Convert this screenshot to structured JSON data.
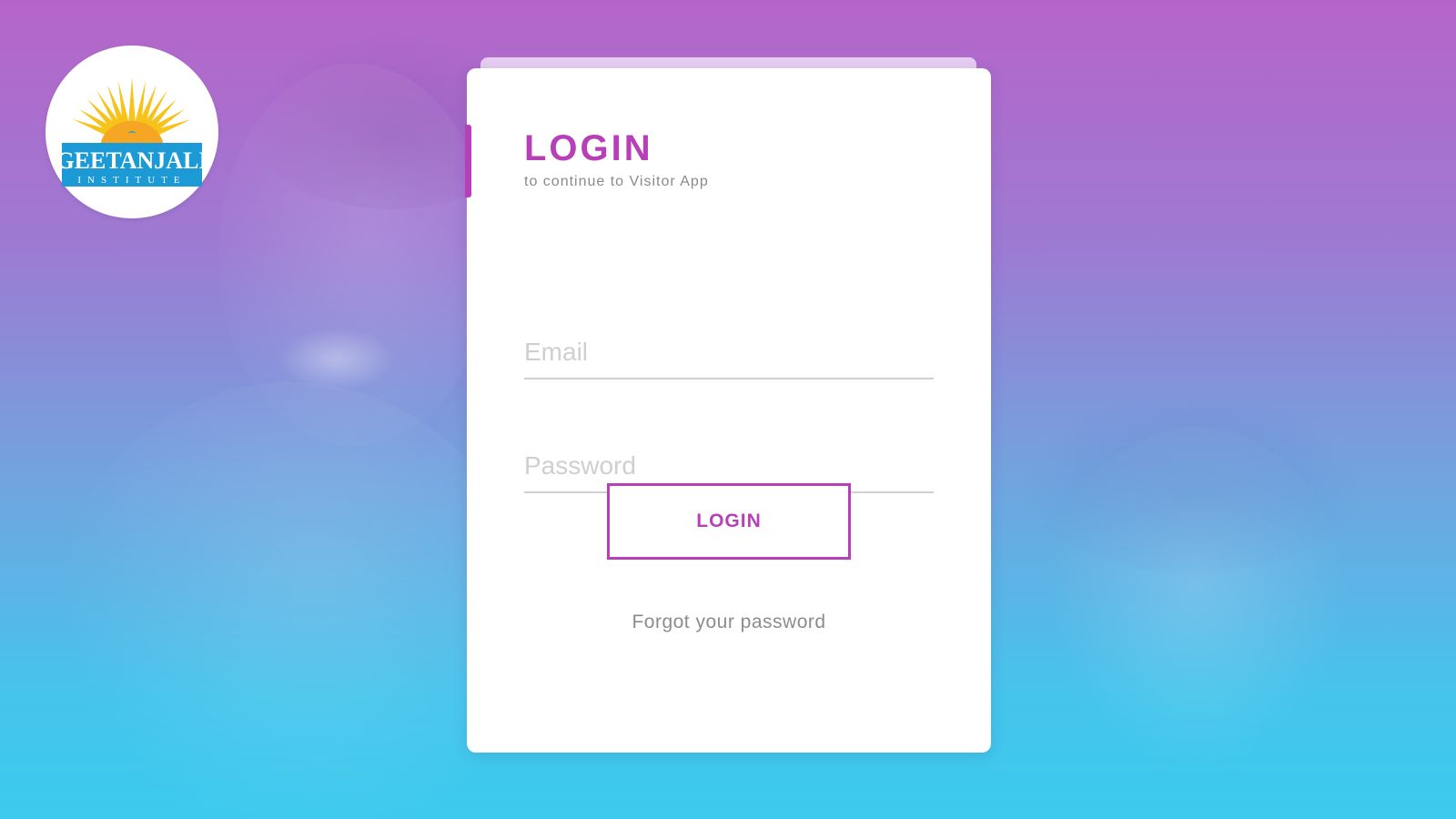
{
  "logo": {
    "name": "GEETANJALI",
    "tagline": "INSTITUTE",
    "colors": {
      "sun": "#f7c21a",
      "ribbon": "#1b9ad6",
      "text": "#ffffff"
    }
  },
  "login": {
    "title": "LOGIN",
    "subtitle": "to continue to Visitor App",
    "email_placeholder": "Email",
    "password_placeholder": "Password",
    "button_label": "LOGIN",
    "forgot_label": "Forgot your password"
  },
  "theme": {
    "accent": "#b73fb8",
    "background_top": "#b565c9",
    "background_bottom": "#3ccaee"
  }
}
